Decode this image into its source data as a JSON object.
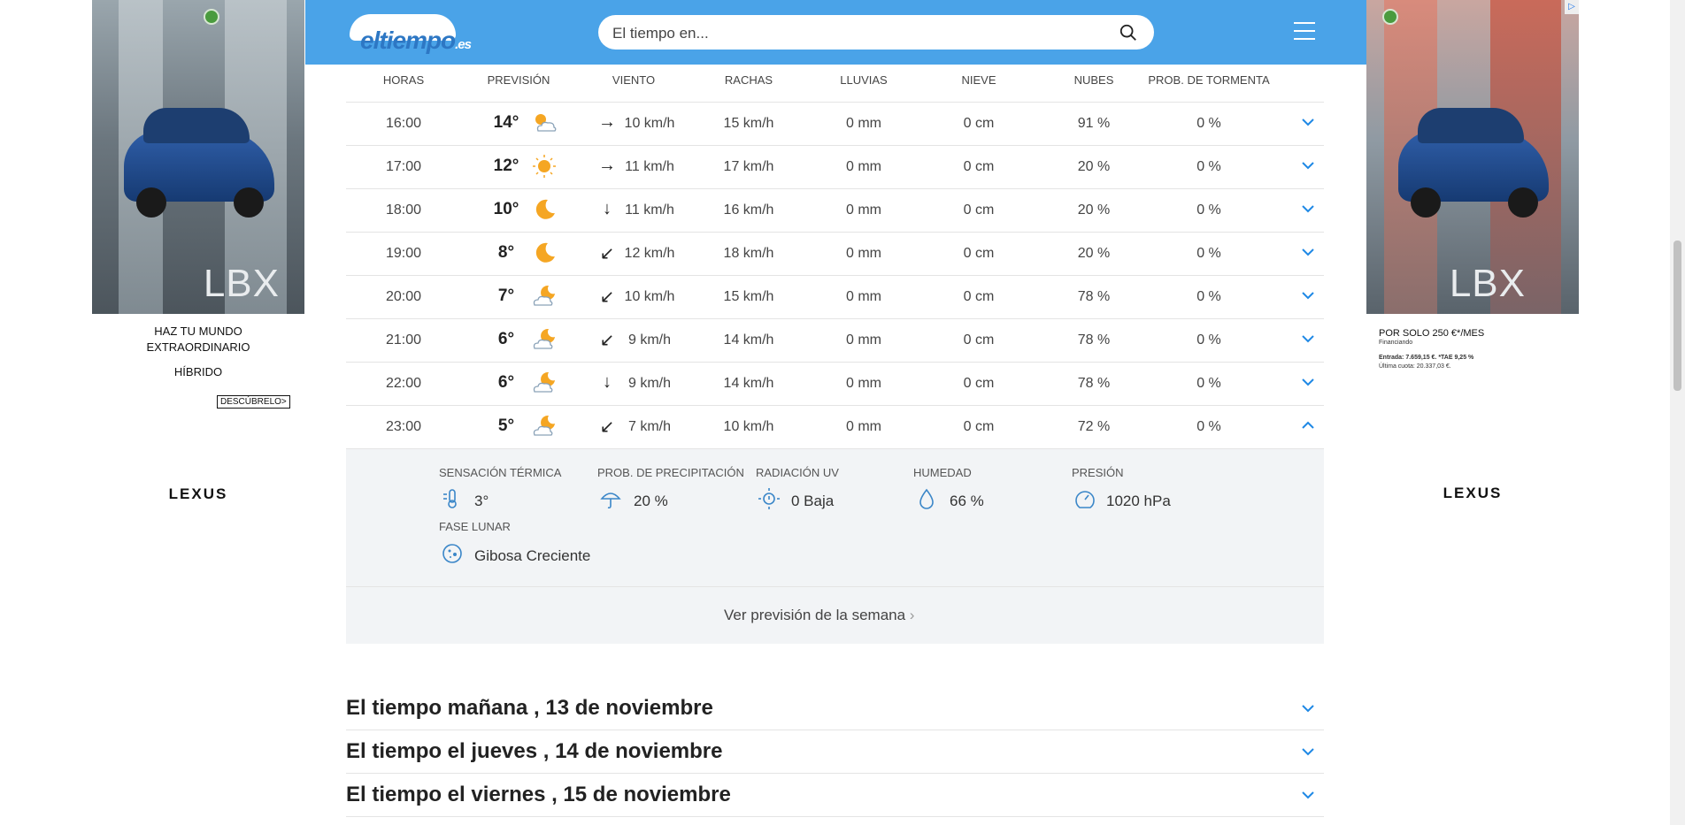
{
  "header": {
    "logo_text": "eltiempo",
    "logo_suffix": ".es",
    "search_placeholder": "El tiempo en..."
  },
  "table": {
    "columns": [
      "HORAS",
      "PREVISIÓN",
      "VIENTO",
      "RACHAS",
      "LLUVIAS",
      "NIEVE",
      "NUBES",
      "PROB. DE TORMENTA"
    ],
    "rows": [
      {
        "hour": "16:00",
        "temp": "14°",
        "icon": "sun-cloud-icon",
        "wind_dir": "→",
        "wind": "10  km/h",
        "gust": "15  km/h",
        "rain": "0 mm",
        "snow": "0 cm",
        "clouds": "91 %",
        "storm": "0 %"
      },
      {
        "hour": "17:00",
        "temp": "12°",
        "icon": "sun-icon",
        "wind_dir": "→",
        "wind": "11  km/h",
        "gust": "17  km/h",
        "rain": "0 mm",
        "snow": "0 cm",
        "clouds": "20 %",
        "storm": "0 %"
      },
      {
        "hour": "18:00",
        "temp": "10°",
        "icon": "moon-icon",
        "wind_dir": "↓",
        "wind": "11  km/h",
        "gust": "16  km/h",
        "rain": "0 mm",
        "snow": "0 cm",
        "clouds": "20 %",
        "storm": "0 %"
      },
      {
        "hour": "19:00",
        "temp": "8°",
        "icon": "moon-icon",
        "wind_dir": "↙",
        "wind": "12  km/h",
        "gust": "18  km/h",
        "rain": "0 mm",
        "snow": "0 cm",
        "clouds": "20 %",
        "storm": "0 %"
      },
      {
        "hour": "20:00",
        "temp": "7°",
        "icon": "moon-cloud-icon",
        "wind_dir": "↙",
        "wind": "10  km/h",
        "gust": "15  km/h",
        "rain": "0 mm",
        "snow": "0 cm",
        "clouds": "78 %",
        "storm": "0 %"
      },
      {
        "hour": "21:00",
        "temp": "6°",
        "icon": "moon-cloud-icon",
        "wind_dir": "↙",
        "wind": "9  km/h",
        "gust": "14  km/h",
        "rain": "0 mm",
        "snow": "0 cm",
        "clouds": "78 %",
        "storm": "0 %"
      },
      {
        "hour": "22:00",
        "temp": "6°",
        "icon": "moon-cloud-icon",
        "wind_dir": "↓",
        "wind": "9  km/h",
        "gust": "14  km/h",
        "rain": "0 mm",
        "snow": "0 cm",
        "clouds": "78 %",
        "storm": "0 %"
      },
      {
        "hour": "23:00",
        "temp": "5°",
        "icon": "moon-cloud-icon",
        "wind_dir": "↙",
        "wind": "7  km/h",
        "gust": "10  km/h",
        "rain": "0 mm",
        "snow": "0 cm",
        "clouds": "72 %",
        "storm": "0 %"
      }
    ]
  },
  "details": {
    "feels_label": "SENSACIÓN TÉRMICA",
    "feels_value": "3°",
    "precip_label": "PROB. DE PRECIPITACIÓN",
    "precip_value": "20 %",
    "uv_label": "RADIACIÓN UV",
    "uv_value": "0 Baja",
    "humidity_label": "HUMEDAD",
    "humidity_value": "66 %",
    "pressure_label": "PRESIÓN",
    "pressure_value": "1020 hPa",
    "moon_label": "FASE LUNAR",
    "moon_value": "Gibosa Creciente"
  },
  "week_link": "Ver previsión de la semana",
  "accordions": [
    "El tiempo mañana , 13 de noviembre",
    "El tiempo el jueves , 14 de noviembre",
    "El tiempo el viernes , 15 de noviembre"
  ],
  "ads": {
    "left": {
      "model": "LBX",
      "line1": "HAZ TU MUNDO",
      "line2": "EXTRAORDINARIO",
      "line3": "HÍBRIDO",
      "cta": "DESCÚBRELO>",
      "brand": "LEXUS"
    },
    "right": {
      "model": "LBX",
      "price": "POR SOLO 250 €*/MES",
      "financing": "Financiando",
      "entrada": "Entrada: 7.659,15 €. *TAE 9,25 %",
      "ultima": "Última cuota: 20.337,03 €.",
      "brand": "LEXUS"
    }
  },
  "colors": {
    "header": "#4aa3e8",
    "accent": "#1e88e5",
    "sun": "#f5a623"
  }
}
